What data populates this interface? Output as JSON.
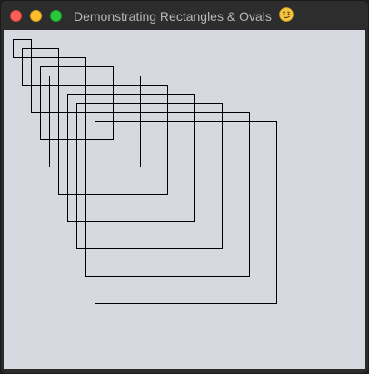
{
  "window": {
    "title": "Demonstrating Rectangles & Ovals",
    "title_emoji_icon": "smirk-face-icon"
  },
  "canvas": {
    "background_color": "#d6d9e0",
    "stroke_color": "#000000",
    "rectangle_count": 10
  }
}
